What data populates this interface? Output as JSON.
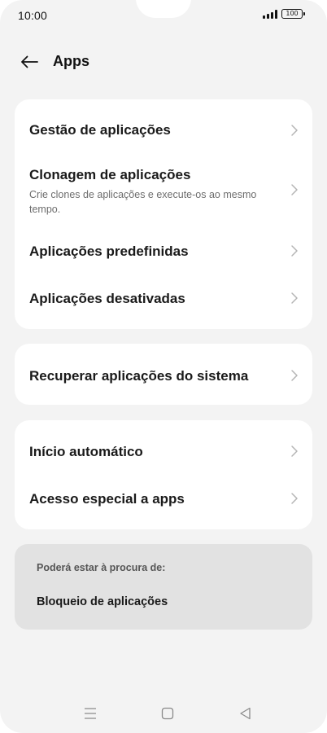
{
  "status_bar": {
    "time": "10:00",
    "battery": "100"
  },
  "header": {
    "back_icon": "arrow-left-icon",
    "title": "Apps"
  },
  "groups": [
    {
      "items": [
        {
          "title": "Gestão de aplicações",
          "subtitle": ""
        },
        {
          "title": "Clonagem de aplicações",
          "subtitle": "Crie clones de aplicações e execute-os ao mesmo tempo."
        },
        {
          "title": "Aplicações predefinidas",
          "subtitle": ""
        },
        {
          "title": "Aplicações desativadas",
          "subtitle": ""
        }
      ]
    },
    {
      "items": [
        {
          "title": "Recuperar aplicações do sistema",
          "subtitle": ""
        }
      ]
    },
    {
      "items": [
        {
          "title": "Início automático",
          "subtitle": ""
        },
        {
          "title": "Acesso especial a apps",
          "subtitle": ""
        }
      ]
    }
  ],
  "suggestion": {
    "label": "Poderá estar à procura de:",
    "item": "Bloqueio de aplicações"
  },
  "nav_bar": {
    "icons": [
      "menu-icon",
      "home-square-icon",
      "back-triangle-icon"
    ]
  },
  "colors": {
    "background": "#f3f3f3",
    "card": "#ffffff",
    "suggestion_bg": "#e2e2e2",
    "chevron": "#b5b5b5"
  }
}
